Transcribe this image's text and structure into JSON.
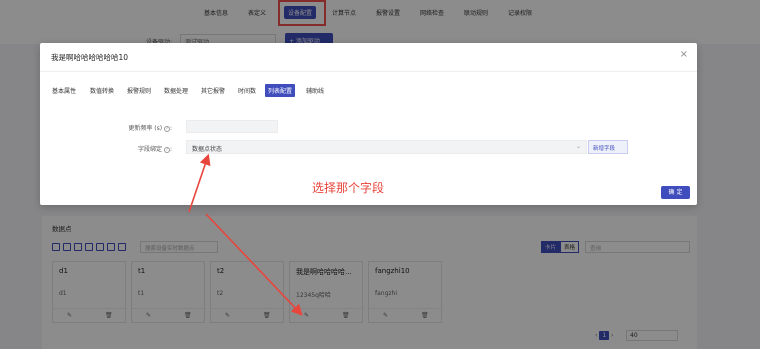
{
  "top_nav": {
    "tabs": [
      "基本信息",
      "表定义",
      "设备配置",
      "计算节点",
      "报警设置",
      "网络检查",
      "联动规则",
      "记录权限"
    ],
    "active_index": 2
  },
  "background": {
    "device_label": "设备驱动:",
    "device_select": "测试驱动",
    "add_button": "+ 添加驱动",
    "section_title": "数据点",
    "search_placeholder": "搜索设备实时数据点",
    "view_toggle": [
      "卡片",
      "表格"
    ],
    "search2_placeholder": "查询",
    "cards": [
      {
        "title": "d1",
        "value": "d1"
      },
      {
        "title": "t1",
        "value": "t1"
      },
      {
        "title": "t2",
        "value": "t2"
      },
      {
        "title": "我是啊哈哈哈哈...",
        "value": "12345q哈哈"
      },
      {
        "title": "fangzhi10",
        "value": "fangzhi"
      }
    ],
    "pager": {
      "current": "1",
      "page_size": "40"
    }
  },
  "modal": {
    "title": "我是啊哈哈哈哈哈哈10",
    "close": "×",
    "tabs": [
      "基本属性",
      "数值转换",
      "报警规则",
      "数据处理",
      "其它报警",
      "时间数",
      "列表配置",
      "辅助线"
    ],
    "active_tab_index": 6,
    "form": {
      "freq_label": "更新频率 (s)",
      "freq_value": "",
      "field_label": "字段绑定",
      "field_value": "数据点状态",
      "add_field_button": "新增字段"
    },
    "confirm_button": "确 定"
  },
  "annotation": {
    "text": "选择那个字段",
    "color": "#e8453c"
  },
  "colors": {
    "accent": "#3f4dbd",
    "highlight": "#f05050"
  }
}
